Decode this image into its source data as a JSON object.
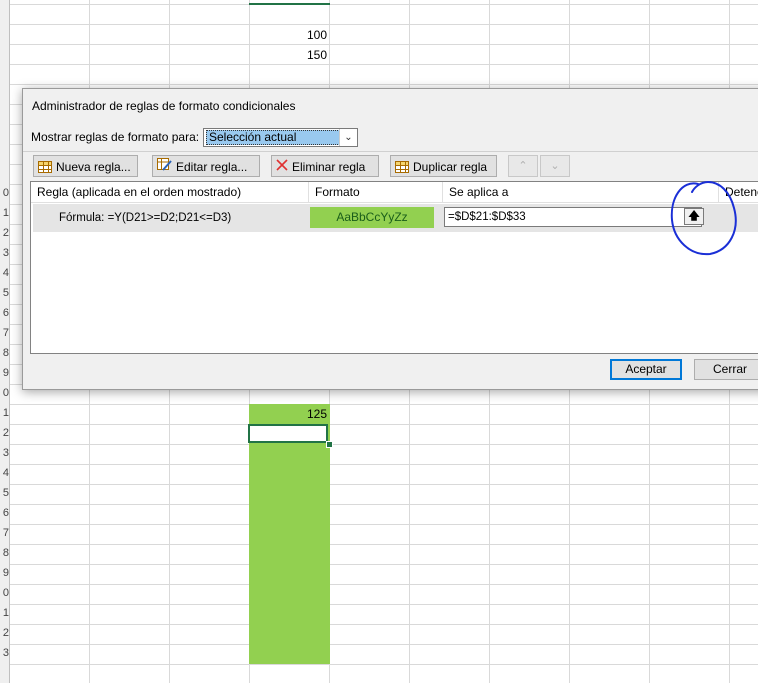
{
  "sheet": {
    "row_labels": [
      "0",
      "1",
      "2",
      "3",
      "4",
      "5",
      "6",
      "7",
      "8",
      "9",
      "0",
      "1",
      "2",
      "3",
      "4",
      "5",
      "6",
      "7",
      "8",
      "9",
      "0",
      "1",
      "2",
      "3"
    ],
    "cells": {
      "v100": "100",
      "v150": "150",
      "v125": "125"
    }
  },
  "dialog": {
    "title": "Administrador de reglas de formato condicionales",
    "show_rules_label": "Mostrar reglas de formato para:",
    "show_rules_value": "Selección actual",
    "toolbar": {
      "new_rule": "Nueva regla...",
      "edit_rule": "Editar regla...",
      "delete_rule": "Eliminar regla",
      "duplicate_rule": "Duplicar regla"
    },
    "columns": {
      "rule": "Regla (aplicada en el orden mostrado)",
      "format": "Formato",
      "applies_to": "Se aplica a",
      "stop": "Detene"
    },
    "rule": {
      "name": "Fórmula: =Y(D21>=D2;D21<=D3)",
      "format_preview": "AaBbCcYyZz",
      "applies_to": "=$D$21:$D$33"
    },
    "buttons": {
      "ok": "Aceptar",
      "close": "Cerrar"
    }
  },
  "colors": {
    "accent": "#217346",
    "format_fill": "#92d050",
    "annotation": "#1a2fd6",
    "selection": "#99c9ef"
  },
  "icons": [
    "new-rule-grid-icon",
    "edit-rule-icon",
    "delete-x-icon",
    "duplicate-grid-icon",
    "move-up-icon",
    "move-down-icon",
    "collapse-dialog-icon",
    "dropdown-arrow-icon"
  ]
}
